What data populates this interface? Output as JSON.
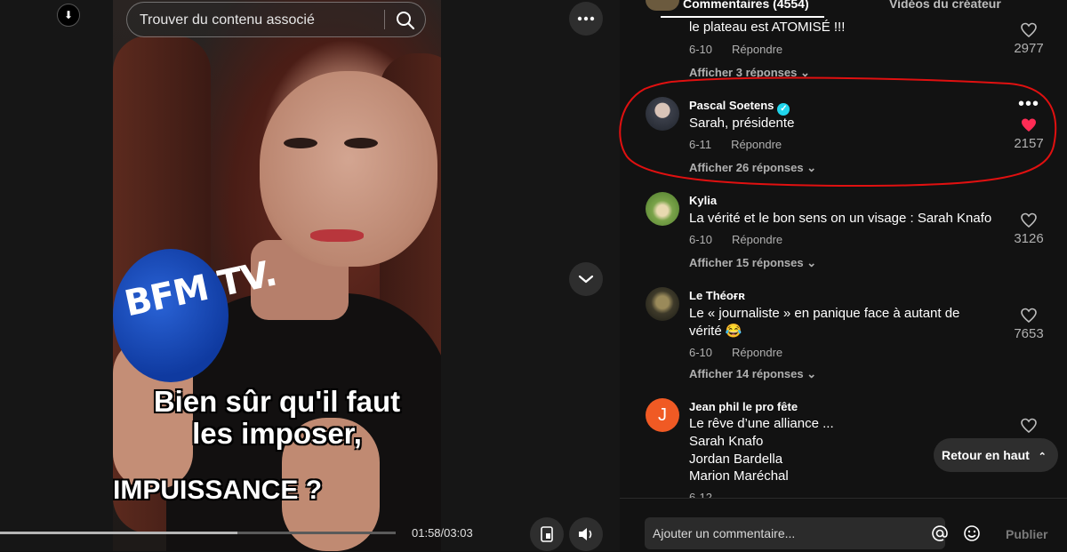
{
  "player": {
    "search_placeholder": "Trouver du contenu associé",
    "caption_line1": "Bien sûr qu'il faut",
    "caption_line2": "les imposer,",
    "caption_line3": "IMPUISSANCE ?",
    "mic_brand": "BFM TV.",
    "time": "01:58/03:03",
    "progress": 0.6,
    "icons": {
      "download": "download-icon",
      "search": "search-icon",
      "more": "more-horizontal-icon",
      "next": "chevron-down-icon",
      "pip": "picture-in-picture-icon",
      "volume": "volume-icon"
    }
  },
  "panel": {
    "tab_comments": "Commentaires (4554)",
    "tab_videos": "Vidéos du créateur",
    "comments": [
      {
        "author": "",
        "text": "le plateau est ATOMISÉ !!!",
        "date": "6-10",
        "reply_label": "Répondre",
        "likes": "2977",
        "replies": "Afficher 3 réponses",
        "liked": false
      },
      {
        "author": "Pascal Soetens",
        "verified": true,
        "text": "Sarah, présidente",
        "date": "6-11",
        "reply_label": "Répondre",
        "likes": "2157",
        "replies": "Afficher 26 réponses",
        "liked": true
      },
      {
        "author": "Kylia",
        "text": "La vérité et le bon sens on un visage : Sarah Knafo",
        "date": "6-10",
        "reply_label": "Répondre",
        "likes": "3126",
        "replies": "Afficher 15 réponses",
        "liked": false
      },
      {
        "author": "Le Théoғʀ",
        "text": "Le « journaliste » en panique face à autant de vérité 😂",
        "date": "6-10",
        "reply_label": "Répondre",
        "likes": "7653",
        "replies": "Afficher 14 réponses",
        "liked": false
      },
      {
        "author": "Jean phil le pro fête",
        "avatar_letter": "J",
        "text_lines": [
          "Le rêve d’une alliance ...",
          "Sarah Knafo",
          "Jordan Bardella",
          "Marion Maréchal"
        ],
        "date": "6-12",
        "liked": false
      }
    ],
    "back_to_top": "Retour en haut",
    "comment_placeholder": "Ajouter un commentaire...",
    "publish": "Publier",
    "colors": {
      "liked_heart": "#fe2c55",
      "annotation": "#e01010",
      "avatar_j": "#f05a24"
    }
  }
}
